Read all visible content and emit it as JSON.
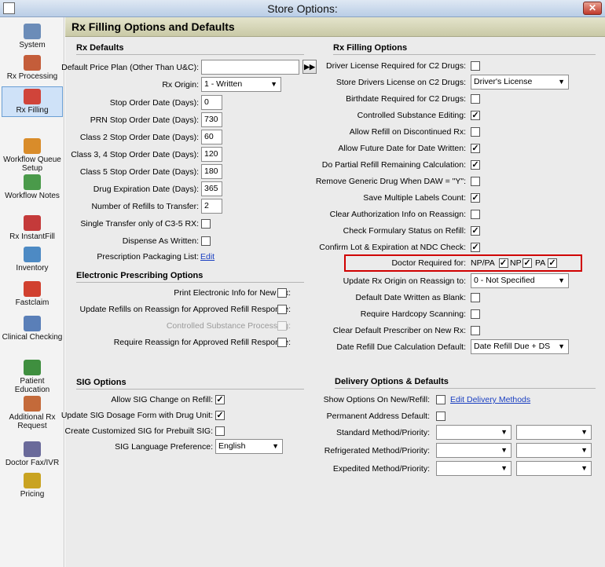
{
  "window": {
    "title": "Store Options:",
    "close": "✕"
  },
  "sidebar": {
    "items": [
      {
        "label": "System",
        "color": "#6b8cb8"
      },
      {
        "label": "Rx Processing",
        "color": "#c45d3a"
      },
      {
        "label": "Rx Filling",
        "color": "#d0443a"
      },
      {
        "label": "Workflow Queue Setup",
        "color": "#d98c2a"
      },
      {
        "label": "Workflow Notes",
        "color": "#4a9a4a"
      },
      {
        "label": "Rx InstantFill",
        "color": "#c43a3a"
      },
      {
        "label": "Inventory",
        "color": "#4d8ac4"
      },
      {
        "label": "Fastclaim",
        "color": "#d1402f"
      },
      {
        "label": "Clinical Checking",
        "color": "#5a7fb8"
      },
      {
        "label": "Patient Education",
        "color": "#3f8f3f"
      },
      {
        "label": "Additional Rx Request",
        "color": "#c46a3a"
      },
      {
        "label": "Doctor Fax/IVR",
        "color": "#6a6a9a"
      },
      {
        "label": "Pricing",
        "color": "#c9a321"
      }
    ]
  },
  "header": {
    "title": "Rx Filling Options and Defaults"
  },
  "rx_defaults": {
    "title": "Rx Defaults",
    "price_plan_label": "Default Price Plan (Other Than U&C):",
    "price_plan_value": "",
    "arrow_button": "▶▶",
    "rx_origin_label": "Rx Origin:",
    "rx_origin_value": "1 - Written",
    "fields": [
      {
        "label": "Stop Order Date (Days):",
        "value": "0"
      },
      {
        "label": "PRN Stop Order Date (Days):",
        "value": "730"
      },
      {
        "label": "Class 2 Stop Order Date (Days):",
        "value": "60"
      },
      {
        "label": "Class 3, 4 Stop Order Date (Days):",
        "value": "120"
      },
      {
        "label": "Class 5 Stop Order Date (Days):",
        "value": "180"
      },
      {
        "label": "Drug Expiration Date (Days):",
        "value": "365"
      },
      {
        "label": "Number of Refills to Transfer:",
        "value": "2"
      }
    ],
    "single_transfer_label": "Single Transfer only of C3-5 RX:",
    "dispense_label": "Dispense As Written:",
    "packaging_label": "Prescription Packaging List:",
    "packaging_link": "Edit"
  },
  "eprescribing": {
    "title": "Electronic Prescribing Options",
    "rows": [
      {
        "label": "Print Electronic Info for New Rx:",
        "checked": "",
        "disabled": false
      },
      {
        "label": "Update Refills on Reassign for Approved Refill Response:",
        "checked": "",
        "disabled": false
      },
      {
        "label": "Controlled Substance Processing:",
        "checked": "",
        "disabled": true
      },
      {
        "label": "Require Reassign for Approved Refill Response:",
        "checked": "",
        "disabled": false
      }
    ]
  },
  "sig": {
    "title": "SIG Options",
    "rows": [
      {
        "label": "Allow SIG Change on Refill:",
        "checked": "✓"
      },
      {
        "label": "Update SIG Dosage Form with Drug Unit:",
        "checked": "✓"
      },
      {
        "label": "Create Customized SIG for Prebuilt SIG:",
        "checked": ""
      }
    ],
    "language_label": "SIG Language Preference:",
    "language_value": "English"
  },
  "filling": {
    "title": "Rx Filling Options",
    "rows": [
      {
        "label": "Driver License Required for C2 Drugs:",
        "type": "cb",
        "checked": ""
      },
      {
        "label": "Store Drivers License on C2 Drugs:",
        "type": "sel",
        "value": "Driver's License"
      },
      {
        "label": "Birthdate Required for C2 Drugs:",
        "type": "cb",
        "checked": ""
      },
      {
        "label": "Controlled Substance Editing:",
        "type": "cb",
        "checked": "✓"
      },
      {
        "label": "Allow Refill on Discontinued Rx:",
        "type": "cb",
        "checked": ""
      },
      {
        "label": "Allow Future Date for Date Written:",
        "type": "cb",
        "checked": "✓"
      },
      {
        "label": "Do Partial Refill Remaining Calculation:",
        "type": "cb",
        "checked": "✓"
      },
      {
        "label": "Remove Generic Drug When DAW = \"Y\":",
        "type": "cb",
        "checked": ""
      },
      {
        "label": "Save Multiple Labels Count:",
        "type": "cb",
        "checked": "✓"
      },
      {
        "label": "Clear Authorization Info on Reassign:",
        "type": "cb",
        "checked": ""
      },
      {
        "label": "Check Formulary Status on Refill:",
        "type": "cb",
        "checked": "✓"
      },
      {
        "label": "Confirm Lot & Expiration at NDC Check:",
        "type": "cb",
        "checked": "✓"
      }
    ],
    "doctor_label": "Doctor Required for:",
    "doctor_opts": [
      {
        "label": "NP/PA",
        "checked": "✓"
      },
      {
        "label": "NP",
        "checked": "✓"
      },
      {
        "label": "PA",
        "checked": "✓"
      }
    ],
    "rows2": [
      {
        "label": "Update Rx Origin on Reassign to:",
        "type": "sel",
        "value": "0 - Not Specified"
      },
      {
        "label": "Default Date Written as Blank:",
        "type": "cb",
        "checked": ""
      },
      {
        "label": "Require Hardcopy Scanning:",
        "type": "cb",
        "checked": ""
      },
      {
        "label": "Clear Default Prescriber on New Rx:",
        "type": "cb",
        "checked": ""
      },
      {
        "label": "Date Refill Due Calculation Default:",
        "type": "sel",
        "value": "Date Refill Due + DS"
      }
    ]
  },
  "delivery": {
    "title": "Delivery Options & Defaults",
    "show_label": "Show Options On New/Refill:",
    "show_checked": "",
    "edit_link": "Edit Delivery Methods",
    "permanent_label": "Permanent Address Default:",
    "permanent_checked": "",
    "methods": [
      {
        "label": "Standard Method/Priority:",
        "method": "",
        "priority": ""
      },
      {
        "label": "Refrigerated Method/Priority:",
        "method": "",
        "priority": ""
      },
      {
        "label": "Expedited Method/Priority:",
        "method": "",
        "priority": ""
      }
    ]
  }
}
